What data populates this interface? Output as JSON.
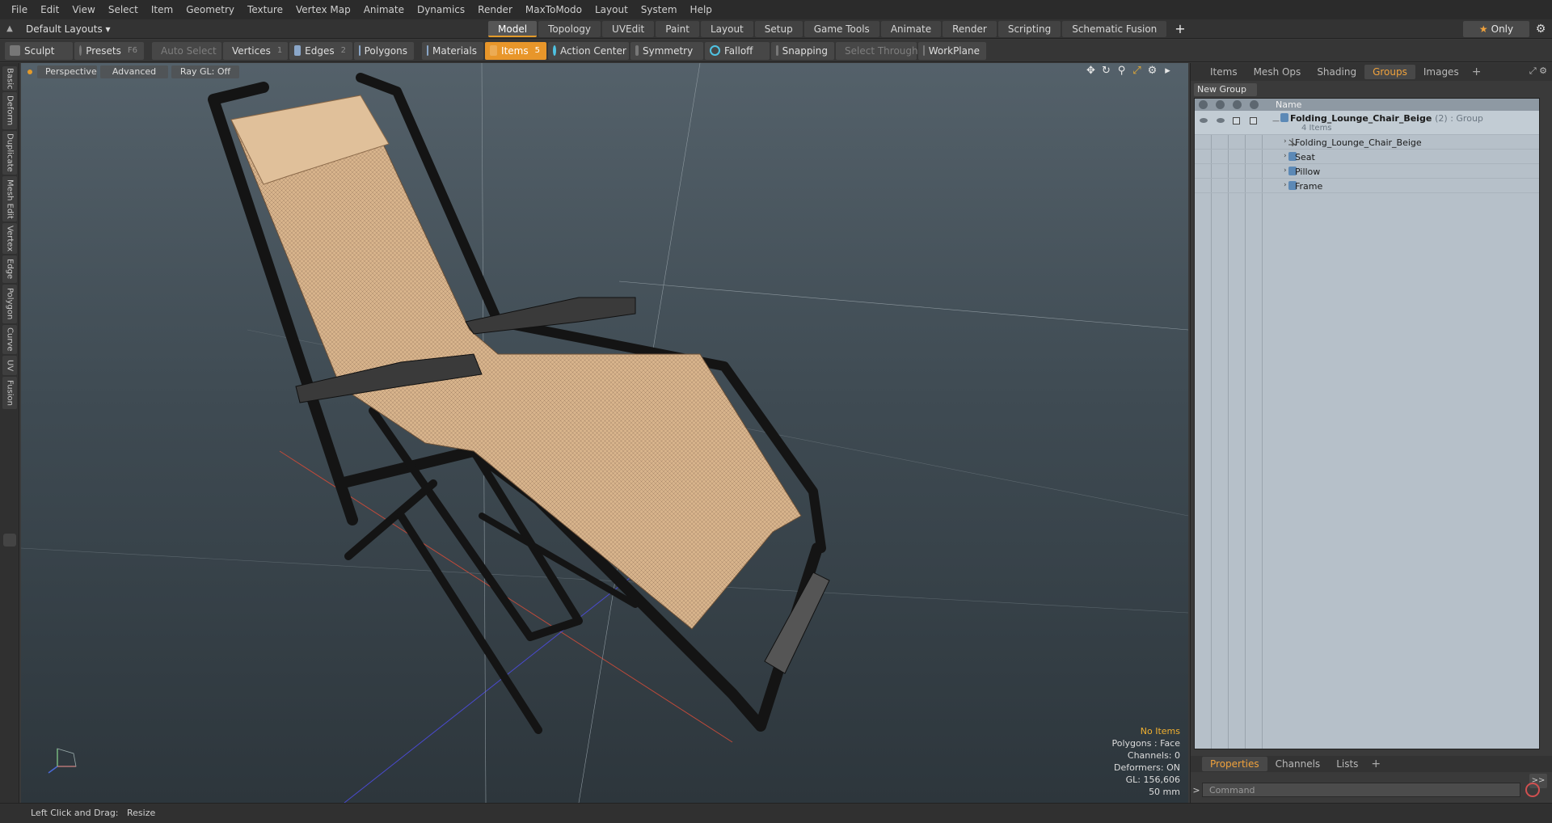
{
  "menubar": {
    "items": [
      "File",
      "Edit",
      "View",
      "Select",
      "Item",
      "Geometry",
      "Texture",
      "Vertex Map",
      "Animate",
      "Dynamics",
      "Render",
      "MaxToModo",
      "Layout",
      "System",
      "Help"
    ]
  },
  "layoutbar": {
    "layout_select": "Default Layouts ▾",
    "tabs": [
      {
        "label": "Model",
        "active": true
      },
      {
        "label": "Topology"
      },
      {
        "label": "UVEdit"
      },
      {
        "label": "Paint"
      },
      {
        "label": "Layout"
      },
      {
        "label": "Setup"
      },
      {
        "label": "Game Tools"
      },
      {
        "label": "Animate"
      },
      {
        "label": "Render"
      },
      {
        "label": "Scripting"
      },
      {
        "label": "Schematic Fusion"
      }
    ],
    "add_label": "+",
    "only_label": "Only"
  },
  "toolbar": {
    "sculpt": "Sculpt",
    "presets": "Presets",
    "presets_key": "F6",
    "auto_select": "Auto Select",
    "vertices": "Vertices",
    "vertices_count": "1",
    "edges": "Edges",
    "edges_count": "2",
    "polygons": "Polygons",
    "materials": "Materials",
    "items": "Items",
    "items_count": "5",
    "action_center": "Action Center",
    "symmetry": "Symmetry",
    "falloff": "Falloff",
    "snapping": "Snapping",
    "select_through": "Select Through",
    "workplane": "WorkPlane"
  },
  "left_tabs": [
    "Basic",
    "Deform",
    "Duplicate",
    "Mesh Edit",
    "Vertex",
    "Edge",
    "Polygon",
    "Curve",
    "UV",
    "Fusion"
  ],
  "viewport": {
    "view_mode": "Perspective",
    "shading": "Advanced",
    "raygl": "Ray GL: Off",
    "info": {
      "selection": "No Items",
      "polygons": "Polygons : Face",
      "channels": "Channels: 0",
      "deformers": "Deformers: ON",
      "gl": "GL: 156,606",
      "scale": "50 mm"
    }
  },
  "right_panel": {
    "tabs": [
      {
        "label": "Items"
      },
      {
        "label": "Mesh Ops"
      },
      {
        "label": "Shading"
      },
      {
        "label": "Groups",
        "active": true
      },
      {
        "label": "Images"
      }
    ],
    "add_tab": "+",
    "new_group": "New Group",
    "column_name": "Name",
    "group": {
      "name": "Folding_Lounge_Chair_Beige",
      "meta": "(2) : Group",
      "count": "4 Items"
    },
    "children": [
      {
        "name": "Folding_Lounge_Chair_Beige",
        "type": "locator"
      },
      {
        "name": "Seat",
        "type": "mesh"
      },
      {
        "name": "Pillow",
        "type": "mesh"
      },
      {
        "name": "Frame",
        "type": "mesh"
      }
    ],
    "bottom_tabs": [
      {
        "label": "Properties",
        "active": true
      },
      {
        "label": "Channels"
      },
      {
        "label": "Lists"
      }
    ],
    "command_placeholder": "Command",
    "expand_label": ">>"
  },
  "statusbar": {
    "hint_label": "Left Click and Drag:",
    "hint_action": "Resize"
  },
  "colors": {
    "accent": "#e8962a",
    "fabric": "#d8b48c",
    "frame": "#141414"
  }
}
